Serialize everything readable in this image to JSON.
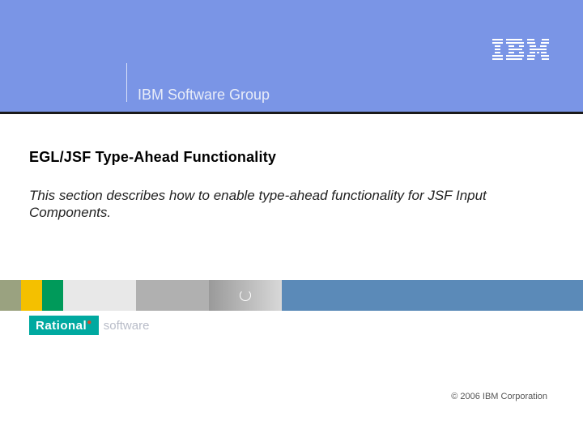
{
  "header": {
    "group_label": "IBM Software Group",
    "logo_name": "ibm-logo"
  },
  "content": {
    "title": "EGL/JSF Type-Ahead Functionality",
    "description": "This section describes how to enable type-ahead functionality for JSF Input Components."
  },
  "branding": {
    "rational_label": "Rational",
    "software_label": "software"
  },
  "footer": {
    "copyright": "© 2006 IBM Corporation"
  }
}
